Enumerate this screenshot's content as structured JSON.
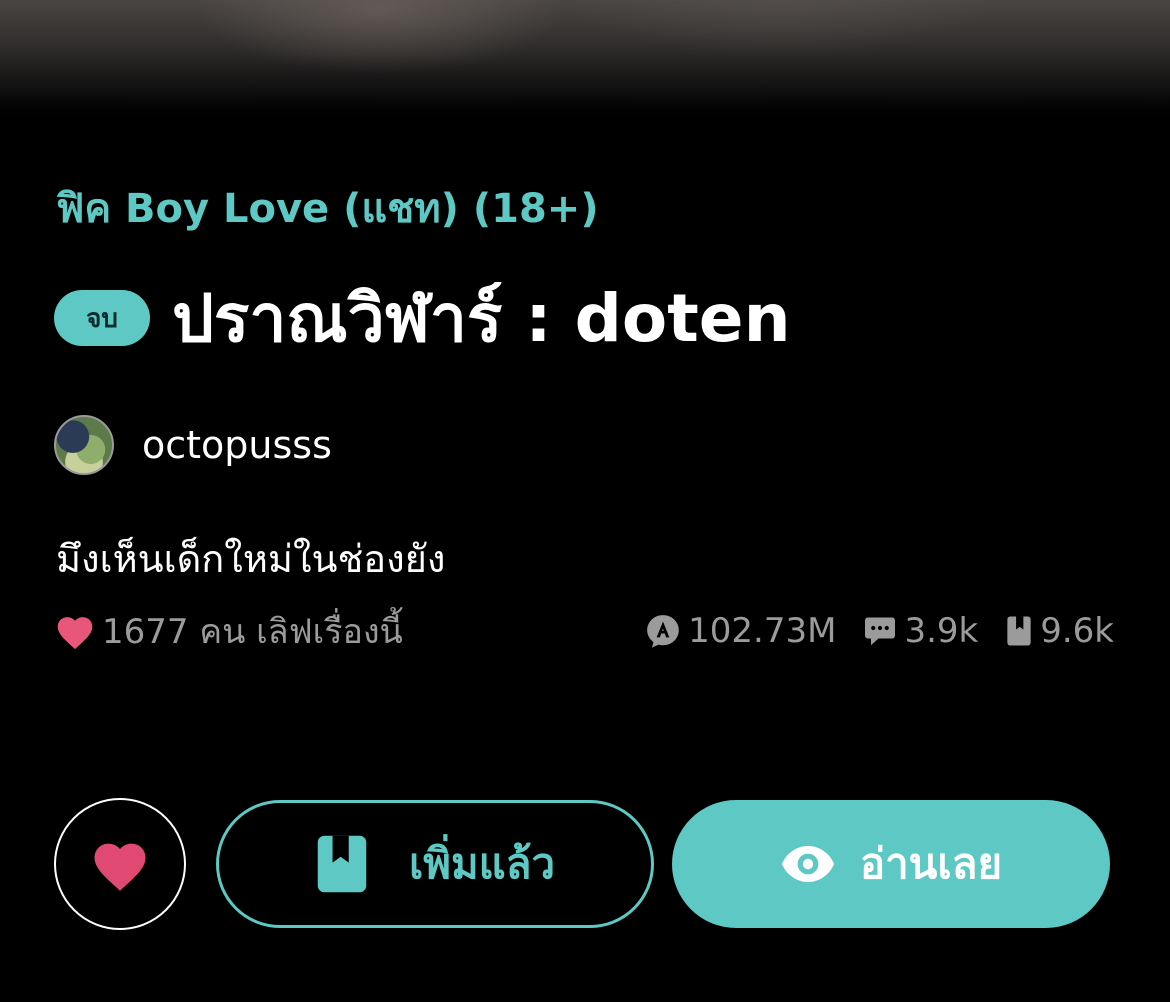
{
  "category": "ฟิค Boy Love (แชท) (18+)",
  "story": {
    "status_badge": "จบ",
    "title": "ปราณวิฬาร์ : doten",
    "author": "octopusss",
    "tagline": "มึงเห็นเด็กใหม่ในช่องยัง"
  },
  "stats": {
    "likes_text": "1677 คน เลิฟเรื่องนี้",
    "views": "102.73M",
    "comments": "3.9k",
    "bookmarks": "9.6k"
  },
  "actions": {
    "added_label": "เพิ่มแล้ว",
    "read_label": "อ่านเลย"
  },
  "colors": {
    "accent": "#5ec8c4",
    "heart": "#e8567a",
    "muted": "#9b9b9b",
    "background": "#000000"
  },
  "icons": {
    "heart": "heart-icon",
    "views": "reader-badge-icon",
    "comments": "chat-bubble-icon",
    "bookmarks": "bookmark-icon",
    "read": "eye-icon"
  }
}
